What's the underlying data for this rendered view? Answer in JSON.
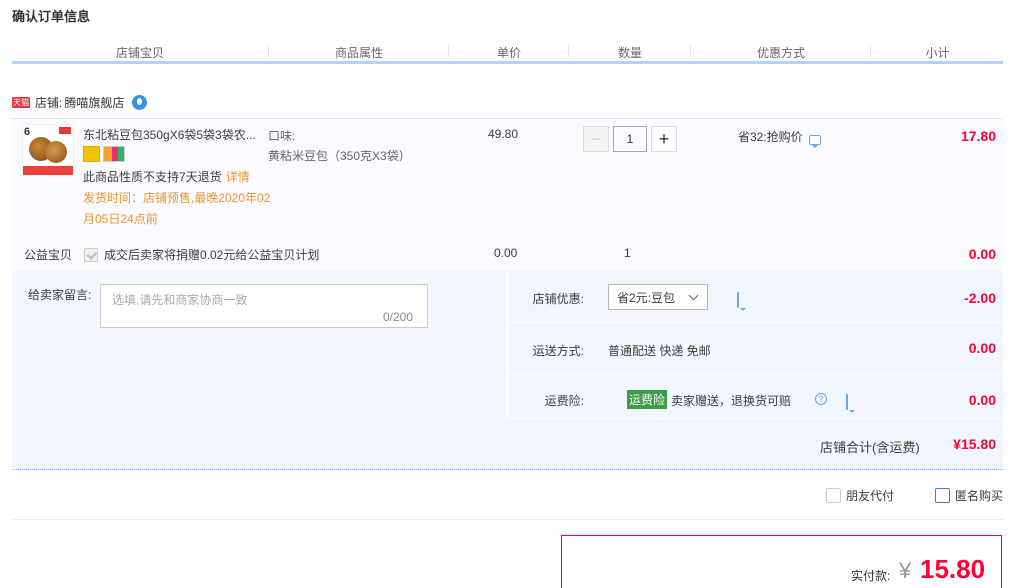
{
  "page_title": "确认订单信息",
  "table_headers": [
    "店铺宝贝",
    "商品属性",
    "单价",
    "数量",
    "优惠方式",
    "小计"
  ],
  "shop": {
    "badge": "天猫",
    "label": "店铺:",
    "name": "腾喵旗舰店"
  },
  "item": {
    "name": "东北粘豆包350gX6袋5袋3袋农...",
    "attr_label": "口味:",
    "attr_value": "黄粘米豆包（350克X3袋）",
    "return_note": "此商品性质不支持7天退货",
    "return_link": "详情",
    "ship_time": "发货时间：店铺预售,最晚2020年02月05日24点前",
    "price": "49.80",
    "quantity": "1",
    "promo": "省32:抢购价",
    "subtotal": "17.80"
  },
  "charity": {
    "label": "公益宝贝",
    "text": "成交后卖家将捐赠0.02元给公益宝贝计划",
    "price": "0.00",
    "qty": "1",
    "subtotal": "0.00"
  },
  "message": {
    "label": "给卖家留言:",
    "placeholder": "选填,请先和商家协商一致",
    "count": "0/200"
  },
  "shop_discount": {
    "label": "店铺优惠:",
    "selected": "省2元:豆包",
    "value": "-2.00"
  },
  "shipping": {
    "label": "运送方式:",
    "text": "普通配送 快递 免邮",
    "value": "0.00"
  },
  "insurance": {
    "label": "运费险:",
    "badge": "运费险",
    "text": "卖家赠送，退换货可赔",
    "value": "0.00"
  },
  "shop_total": {
    "label": "店铺合计(含运费)",
    "value": "¥15.80"
  },
  "options": {
    "friend_pay": "朋友代付",
    "anonymous": "匿名购买"
  },
  "payment": {
    "label": "实付款:",
    "currency": "¥",
    "value": "15.80"
  },
  "colors": {
    "accent_red": "#ff0036",
    "header_border": "#b2d1ff",
    "detail_bg": "#f2f7ff"
  }
}
